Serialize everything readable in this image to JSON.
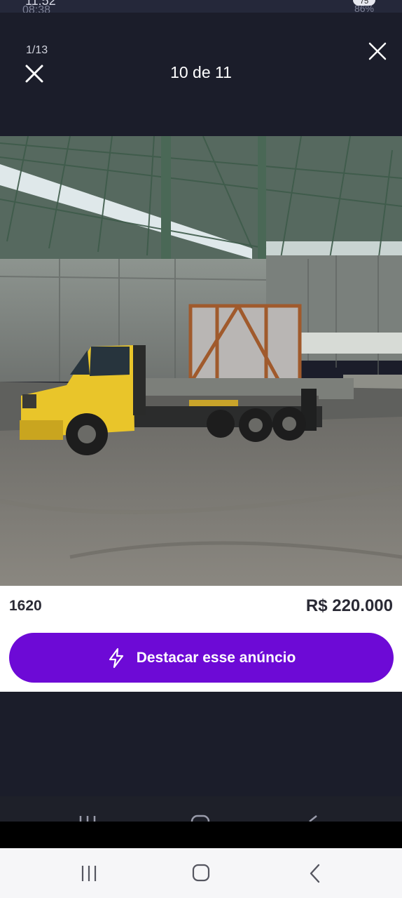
{
  "status_ghost": {
    "time_top": "11:52",
    "time_bottom": "08:38",
    "battery_top": "75",
    "signal_bottom": "86%"
  },
  "header": {
    "image_counter": "1/13",
    "title": "10 de 11"
  },
  "listing": {
    "model": "1620",
    "price": "R$ 220.000",
    "highlight_button_label": "Destacar esse anúncio"
  },
  "colors": {
    "background": "#1b1d2a",
    "accent": "#6d0ad6",
    "panel": "#ffffff"
  },
  "icons": {
    "close_left": "close-icon",
    "close_right": "close-icon",
    "highlight": "lightning-bolt-icon",
    "nav_recents": "recents-icon",
    "nav_home": "home-icon",
    "nav_back": "back-icon"
  }
}
